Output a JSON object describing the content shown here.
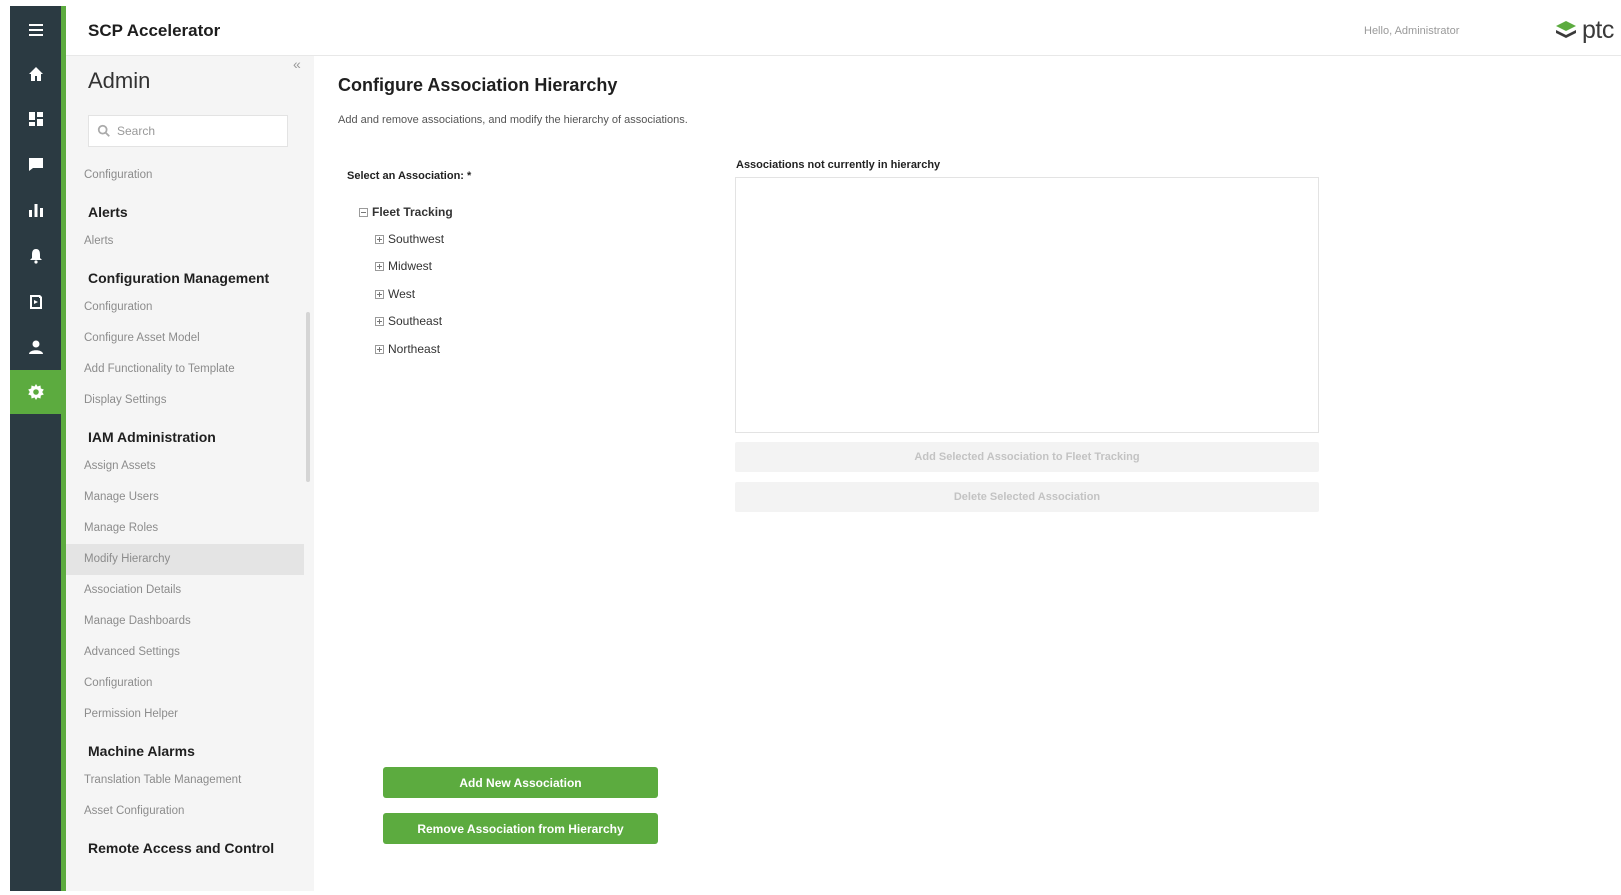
{
  "header": {
    "app_title": "SCP Accelerator",
    "user_greeting": "Hello, Administrator",
    "logo_text": "ptc"
  },
  "rail": {
    "items": [
      {
        "icon": "menu-icon",
        "active": false
      },
      {
        "icon": "home-icon",
        "active": false
      },
      {
        "icon": "dashboard-icon",
        "active": false
      },
      {
        "icon": "chat-icon",
        "active": false
      },
      {
        "icon": "bar-chart-icon",
        "active": false
      },
      {
        "icon": "bell-icon",
        "active": false
      },
      {
        "icon": "remote-icon",
        "active": false
      },
      {
        "icon": "user-icon",
        "active": false
      },
      {
        "icon": "gear-icon",
        "active": true
      }
    ],
    "accent_color": "#5cab3f",
    "background_color": "#2b3a42"
  },
  "sidebar": {
    "title": "Admin",
    "collapse_label": "«",
    "search_placeholder": "Search",
    "top_item": "Configuration",
    "groups": [
      {
        "label": "Alerts",
        "items": [
          "Alerts"
        ]
      },
      {
        "label": "Configuration Management",
        "items": [
          "Configuration",
          "Configure Asset Model",
          "Add Functionality to Template",
          "Display Settings"
        ]
      },
      {
        "label": "IAM Administration",
        "items": [
          "Assign Assets",
          "Manage Users",
          "Manage Roles",
          "Modify Hierarchy",
          "Association Details",
          "Manage Dashboards",
          "Advanced Settings",
          "Configuration",
          "Permission Helper"
        ]
      },
      {
        "label": "Machine Alarms",
        "items": [
          "Translation Table Management",
          "Asset Configuration"
        ]
      },
      {
        "label": "Remote Access and Control",
        "items": []
      }
    ],
    "selected_item": "Modify Hierarchy"
  },
  "main": {
    "title": "Configure Association Hierarchy",
    "subtitle": "Add and remove associations, and modify the hierarchy of associations.",
    "select_label": "Select an Association: *",
    "tree": {
      "root": "Fleet Tracking",
      "children": [
        "Southwest",
        "Midwest",
        "West",
        "Southeast",
        "Northeast"
      ]
    },
    "not_in_hierarchy_label": "Associations not currently in hierarchy",
    "add_selected_button": "Add Selected Association to Fleet Tracking",
    "delete_selected_button": "Delete Selected Association",
    "add_new_button": "Add New Association",
    "remove_button": "Remove Association from Hierarchy"
  }
}
